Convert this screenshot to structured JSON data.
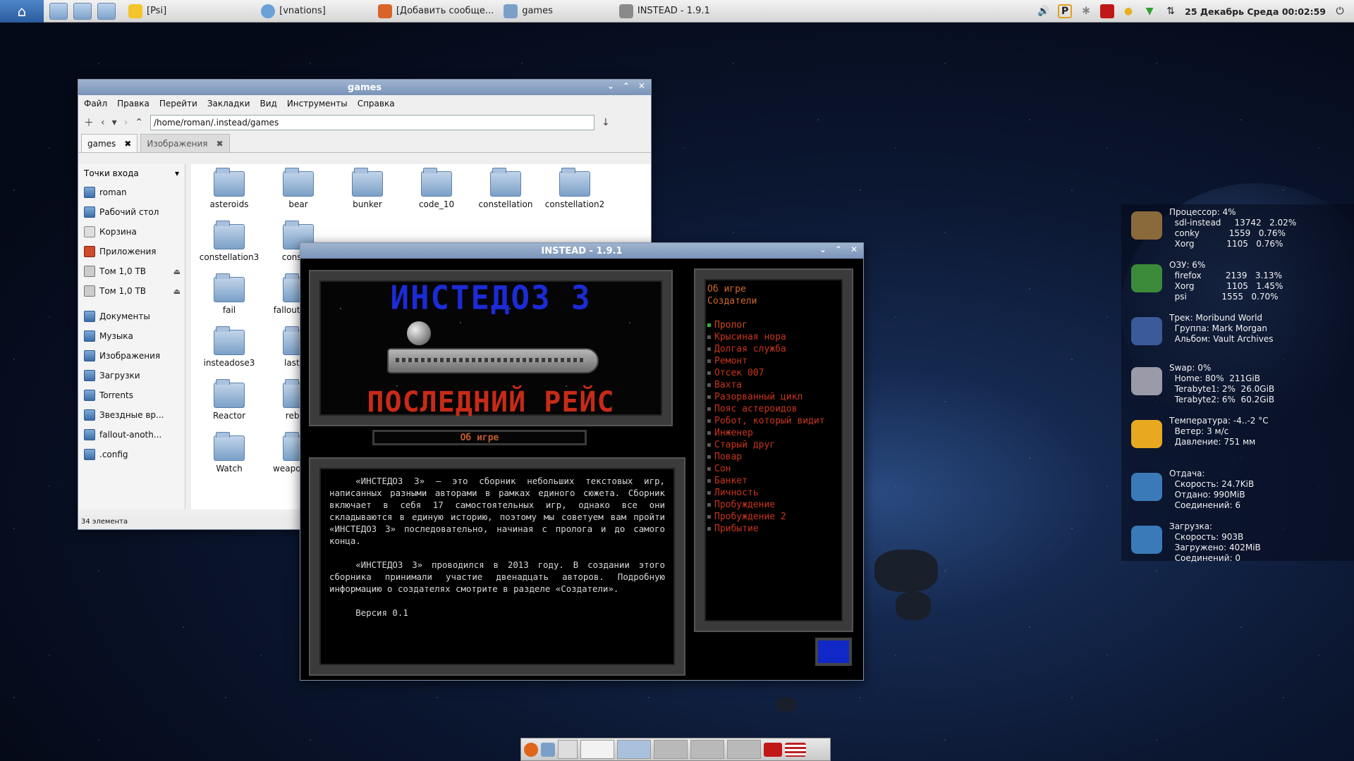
{
  "panel": {
    "tasks": [
      {
        "label": "[Psi]",
        "icon": "bulb-icon"
      },
      {
        "label": "[vnations]",
        "icon": "chat-bubble-icon"
      },
      {
        "label": "[Добавить сообще...",
        "icon": "app-icon"
      },
      {
        "label": "games",
        "icon": "folder-icon"
      },
      {
        "label": "INSTEAD - 1.9.1",
        "icon": "instead-icon"
      }
    ],
    "clock": "25 Декабрь Среда 00:02:59"
  },
  "filemanager": {
    "title": "games",
    "menu": [
      "Файл",
      "Правка",
      "Перейти",
      "Закладки",
      "Вид",
      "Инструменты",
      "Справка"
    ],
    "address": "/home/roman/.instead/games",
    "tabs": [
      "games",
      "Изображения"
    ],
    "sidebar_header": "Точки входа",
    "places": [
      "roman",
      "Рабочий стол",
      "Корзина",
      "Приложения",
      "Том 1,0 TB",
      "Том 1,0 TB"
    ],
    "bookmarks": [
      "Документы",
      "Музыка",
      "Изображения",
      "Загрузки",
      "Torrents",
      "Звездные вр...",
      "fallout-anoth...",
      ".config"
    ],
    "files": [
      "asteroids",
      "bear",
      "bunker",
      "code_10",
      "constellation",
      "constellation2",
      "constellation3",
      "constell",
      "fail",
      "fallout-a sid",
      "insteadose3",
      "last_ra",
      "Reactor",
      "rebel_",
      "Watch",
      "weapon_ ua"
    ],
    "status": "34 элемента"
  },
  "instead": {
    "title": "INSTEAD - 1.9.1",
    "banner_title": "ИНСТЕДОЗ 3",
    "banner_subtitle": "ПОСЛЕДНИЙ РЕЙС",
    "section_label": "Об игре",
    "paragraph1": "«ИНСТЕДОЗ 3» — это сборник небольших текстовых игр, написанных разными авторами в рамках единого сюжета. Сборник включает в себя 17 самостоятельных игр, однако все они складываются в единую историю, поэтому мы советуем вам пройти «ИНСТЕДОЗ 3» последовательно, начиная с пролога и до самого конца.",
    "paragraph2": "«ИНСТЕДОЗ 3» проводился в 2013 году. В создании этого сборника принимали участие двенадцать авторов. Подробную информацию о создателях смотрите в разделе «Создатели».",
    "version": "Версия 0.1",
    "menu_top": [
      "Об игре",
      "Создатели"
    ],
    "menu_items": [
      "Пролог",
      "Крысиная нора",
      "Долгая служба",
      "Ремонт",
      "Отсек 007",
      "Вахта",
      "Разорванный цикл",
      "Пояс астероидов",
      "Робот, который видит",
      "Инженер",
      "Старый друг",
      "Повар",
      "Сон",
      "Банкет",
      "Личность",
      "Пробуждение",
      "Пробуждение 2",
      "Прибытие"
    ]
  },
  "conky": {
    "cpu": "Процессор: 4%\n  sdl-instead     13742   2.02%\n  conky           1559   0.76%\n  Xorg            1105   0.76%",
    "ram": "ОЗУ: 6%\n  firefox         2139   3.13%\n  Xorg            1105   1.45%\n  psi             1555   0.70%",
    "music": "Трек: Moribund World\n  Группа: Mark Morgan\n  Альбом: Vault Archives",
    "swap": "Swap: 0%\n  Home: 80%  211GiB\n  Terabyte1: 2%  26.0GiB\n  Terabyte2: 6%  60.2GiB",
    "weather": "Температура: -4..-2 °C\n  Ветер: 3 м/с\n  Давление: 751 мм",
    "upload": "Отдача:\n  Скорость: 24.7KiB\n  Отдано: 990MiB\n  Соединений: 6",
    "download": "Загрузка:\n  Скорость: 903B\n  Загружено: 402MiB\n  Соединений: 0"
  },
  "colors": {
    "accent": "#7a93b8",
    "menu_item": "#c8341c",
    "banner_blue": "#1c2bd6",
    "banner_red": "#c82a18"
  }
}
